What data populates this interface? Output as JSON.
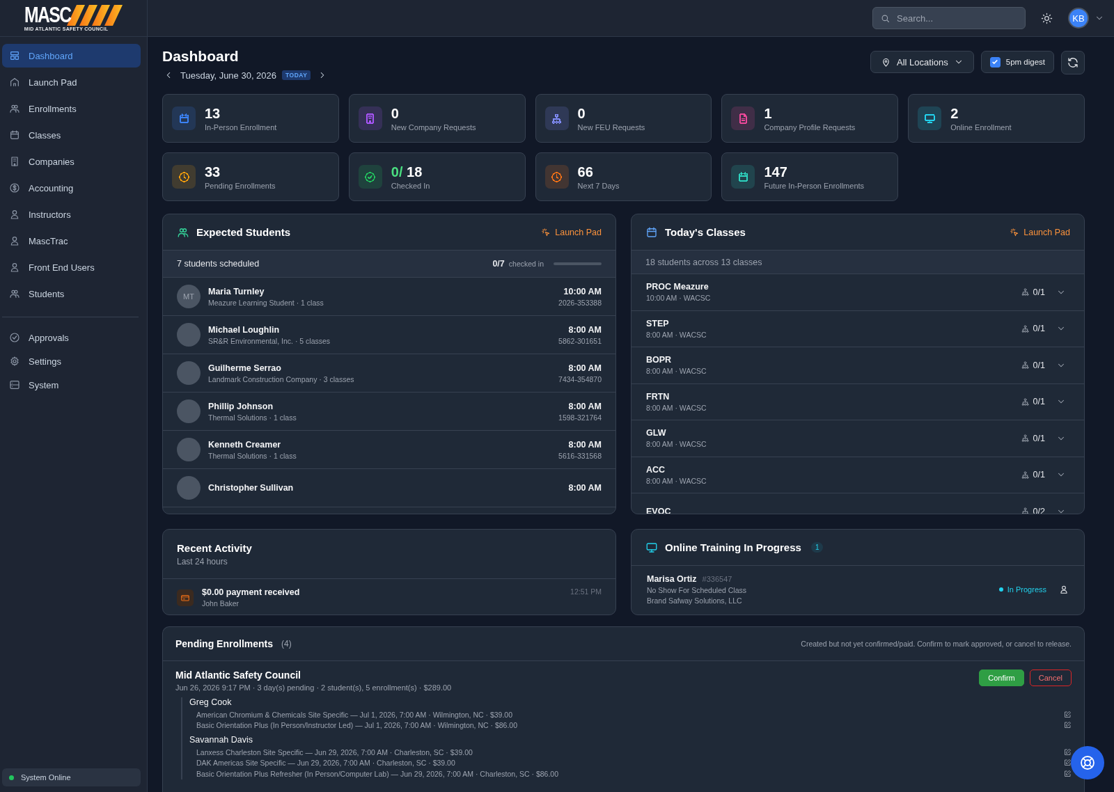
{
  "header": {
    "logo": {
      "name": "MASC",
      "tagline": "MID ATLANTIC SAFETY COUNCIL"
    },
    "search": {
      "placeholder": "Search..."
    },
    "avatar": "KB"
  },
  "sidebar": {
    "items": [
      {
        "label": "Dashboard",
        "selected": true
      },
      {
        "label": "Launch Pad",
        "selected": false
      },
      {
        "label": "Enrollments",
        "selected": false
      },
      {
        "label": "Classes",
        "selected": false
      },
      {
        "label": "Companies",
        "selected": false
      },
      {
        "label": "Accounting",
        "selected": false
      },
      {
        "label": "Instructors",
        "selected": false
      },
      {
        "label": "MascTrac",
        "selected": false
      },
      {
        "label": "Front End Users",
        "selected": false
      },
      {
        "label": "Students",
        "selected": false
      }
    ],
    "secondary_items": [
      {
        "label": "Approvals",
        "selected": false
      },
      {
        "label": "Settings",
        "selected": false
      },
      {
        "label": "System",
        "selected": false
      }
    ],
    "status": "System Online"
  },
  "page": {
    "title": "Dashboard",
    "date": "Tuesday, June 30, 2026",
    "date_badge": "TODAY",
    "location": "All Locations",
    "digest": {
      "label": "5pm digest",
      "checked": true
    }
  },
  "stats": [
    {
      "kind": "count",
      "value": "13",
      "label": "In-Person Enrollment",
      "color": "#3b82f6"
    },
    {
      "kind": "count",
      "value": "0",
      "label": "New Company Requests",
      "color": "#a855f7"
    },
    {
      "kind": "count",
      "value": "0",
      "label": "New FEU Requests",
      "color": "#818cf8"
    },
    {
      "kind": "count",
      "value": "1",
      "label": "Company Profile Requests",
      "color": "#ec4899"
    },
    {
      "kind": "count",
      "value": "2",
      "label": "Online Enrollment",
      "color": "#22d3ee"
    },
    {
      "kind": "count",
      "value": "33",
      "label": "Pending Enrollments",
      "color": "#f59e0b"
    },
    {
      "kind": "ratio",
      "done": "0/",
      "total": "18",
      "label": "Checked In",
      "color": "#22c55e"
    },
    {
      "kind": "count",
      "value": "66",
      "label": "Next 7 Days",
      "color": "#f97316"
    },
    {
      "kind": "count",
      "value": "147",
      "label": "Future In-Person Enrollments",
      "color": "#2dd4bf"
    }
  ],
  "expected_students": {
    "title": "Expected Students",
    "link": "Launch Pad",
    "summary": "7 students scheduled",
    "checked": "0/7",
    "checked_label": "checked in",
    "level": 0,
    "rows": [
      {
        "initials": "MT",
        "name": "Maria Turnley",
        "detail": "Meazure Learning Student · 1 class",
        "time": "10:00 AM",
        "code": "2026-353388"
      },
      {
        "name": "Michael Loughlin",
        "detail": "SR&R Environmental, Inc. · 5 classes",
        "time": "8:00 AM",
        "code": "5862-301651"
      },
      {
        "name": "Guilherme Serrao",
        "detail": "Landmark Construction Company · 3 classes",
        "time": "8:00 AM",
        "code": "7434-354870"
      },
      {
        "name": "Phillip Johnson",
        "detail": "Thermal Solutions · 1 class",
        "time": "8:00 AM",
        "code": "1598-321764"
      },
      {
        "name": "Kenneth Creamer",
        "detail": "Thermal Solutions · 1 class",
        "time": "8:00 AM",
        "code": "5616-331568"
      },
      {
        "name": "Christopher Sullivan",
        "time": "8:00 AM"
      }
    ]
  },
  "todays_classes": {
    "title": "Today's Classes",
    "link": "Launch Pad",
    "summary": "18 students across 13 classes",
    "rows": [
      {
        "name": "PROC Meazure",
        "detail": "10:00 AM · WACSC",
        "count": "0/1"
      },
      {
        "name": "STEP",
        "detail": "8:00 AM · WACSC",
        "count": "0/1"
      },
      {
        "name": "BOPR",
        "detail": "8:00 AM · WACSC",
        "count": "0/1"
      },
      {
        "name": "FRTN",
        "detail": "8:00 AM · WACSC",
        "count": "0/1"
      },
      {
        "name": "GLW",
        "detail": "8:00 AM · WACSC",
        "count": "0/1"
      },
      {
        "name": "ACC",
        "detail": "8:00 AM · WACSC",
        "count": "0/1"
      },
      {
        "name": "EVOC",
        "count": "0/2"
      }
    ]
  },
  "recent_activity": {
    "title": "Recent Activity",
    "subtitle": "Last 24 hours",
    "items": [
      {
        "text": "$0.00 payment received",
        "person": "John Baker",
        "time": "12:51 PM"
      }
    ]
  },
  "online_training": {
    "title": "Online Training In Progress",
    "count": "1",
    "items": [
      {
        "name": "Marisa Ortiz",
        "id": "#336547",
        "reason": "No Show For Scheduled Class",
        "company": "Brand Safway Solutions, LLC",
        "status": "In Progress"
      }
    ]
  },
  "pending": {
    "title": "Pending Enrollments",
    "count": "(4)",
    "note": "Created but not yet confirmed/paid. Confirm to mark approved, or cancel to release.",
    "groups": [
      {
        "org": "Mid Atlantic Safety Council",
        "meta": "Jun 26, 2026 9:17 PM · 3 day(s) pending · 2 student(s), 5 enrollment(s) · $289.00",
        "actions": [
          "Confirm",
          "Cancel"
        ],
        "students": [
          {
            "name": "Greg Cook",
            "lines": [
              "American Chromium & Chemicals Site Specific — Jul 1, 2026, 7:00 AM · Wilmington, NC · $39.00",
              "Basic Orientation Plus (In Person/Instructor Led) — Jul 1, 2026, 7:00 AM · Wilmington, NC · $86.00"
            ]
          },
          {
            "name": "Savannah Davis",
            "lines": [
              "Lanxess Charleston Site Specific — Jun 29, 2026, 7:00 AM · Charleston, SC · $39.00",
              "DAK Americas Site Specific — Jun 29, 2026, 7:00 AM · Charleston, SC · $39.00",
              "Basic Orientation Plus Refresher (In Person/Computer Lab) — Jun 29, 2026, 7:00 AM · Charleston, SC · $86.00"
            ]
          }
        ]
      }
    ]
  }
}
